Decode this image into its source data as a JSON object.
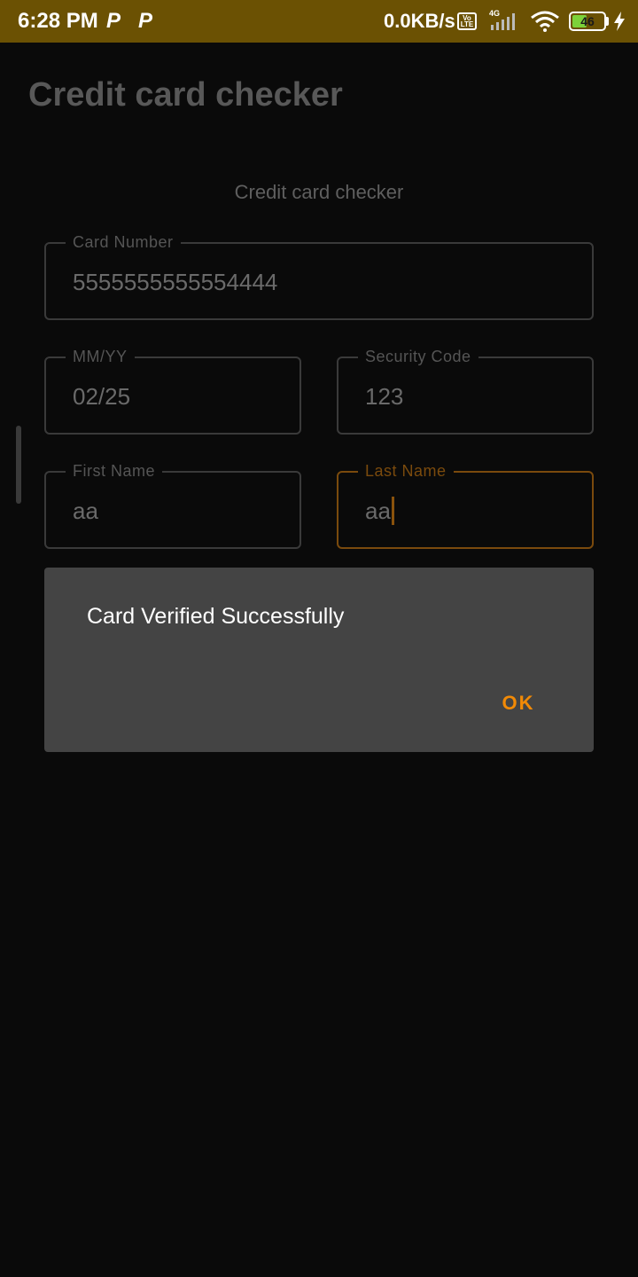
{
  "status_bar": {
    "time": "6:28 PM",
    "notification_icons": [
      "P",
      "P"
    ],
    "network_speed": "0.0KB/s",
    "volte_label": "Vo LTE",
    "network_type": "4G",
    "battery_percent": "46",
    "battery_level": 0.46,
    "charging": true,
    "background_color": "#6b5103"
  },
  "app_bar": {
    "title": "Credit card checker"
  },
  "form": {
    "heading": "Credit card checker",
    "fields": {
      "card_number": {
        "label": "Card Number",
        "value": "5555555555554444"
      },
      "expiry": {
        "label": "MM/YY",
        "value": "02/25"
      },
      "security_code": {
        "label": "Security Code",
        "value": "123"
      },
      "first_name": {
        "label": "First Name",
        "value": "aa"
      },
      "last_name": {
        "label": "Last Name",
        "value": "aa",
        "focused": true
      }
    }
  },
  "dialog": {
    "message": "Card Verified Successfully",
    "ok_label": "OK",
    "accent_color": "#f28a06"
  },
  "colors": {
    "background": "#0a0a0a",
    "dialog_background": "#444444",
    "focus_outline": "#7a4a0d"
  }
}
